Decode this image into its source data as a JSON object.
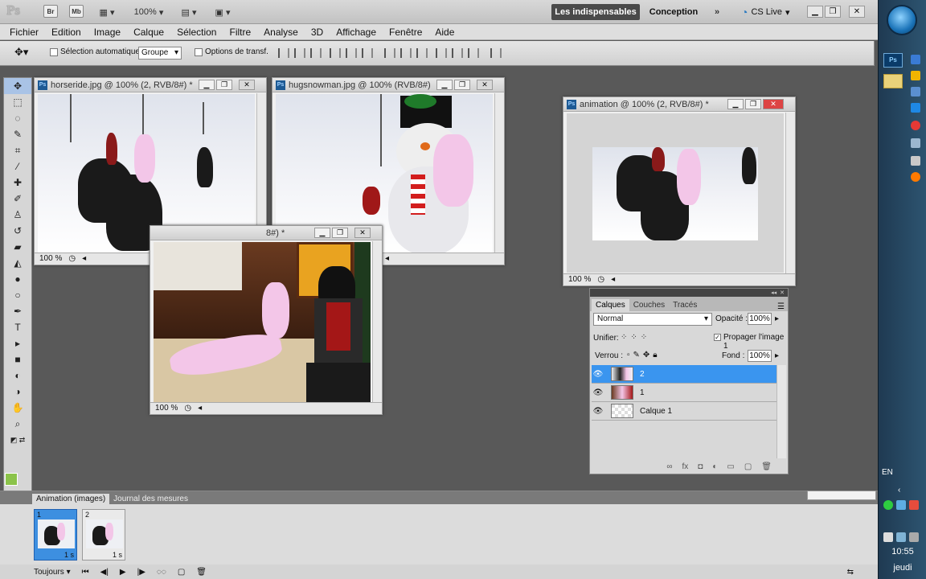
{
  "app": {
    "logo": "Ps",
    "mini_buttons": [
      "Br",
      "Mb"
    ],
    "zoom": "100%",
    "workspace_active": "Les indispensables",
    "workspace_other": "Conception",
    "cs_live": "CS Live"
  },
  "menu": [
    "Fichier",
    "Edition",
    "Image",
    "Calque",
    "Sélection",
    "Filtre",
    "Analyse",
    "3D",
    "Affichage",
    "Fenêtre",
    "Aide"
  ],
  "options": {
    "auto_select_label": "Sélection automatique :",
    "auto_select_value": "Groupe",
    "transform_label": "Options de transf."
  },
  "documents": [
    {
      "title": "horseride.jpg @ 100% (2, RVB/8#) *",
      "zoom": "100 %"
    },
    {
      "title": "hugsnowman.jpg @ 100% (RVB/8#)",
      "zoom": ""
    },
    {
      "title": "8#) *",
      "zoom": "100 %"
    },
    {
      "title": "animation  @ 100% (2, RVB/8#) *",
      "zoom": "100 %"
    }
  ],
  "layers_panel": {
    "tabs": [
      "Calques",
      "Couches",
      "Tracés"
    ],
    "blend_mode": "Normal",
    "opacity_label": "Opacité :",
    "opacity": "100%",
    "unify_label": "Unifier:",
    "propagate_label": "Propager l'image 1",
    "lock_label": "Verrou :",
    "fill_label": "Fond :",
    "fill": "100%",
    "layers": [
      {
        "name": "2",
        "selected": true
      },
      {
        "name": "1",
        "selected": false
      },
      {
        "name": "Calque 1",
        "selected": false
      }
    ]
  },
  "animation": {
    "tabs": [
      "Animation (images)",
      "Journal des mesures"
    ],
    "frames": [
      {
        "number": "1",
        "delay": "1 s",
        "selected": true
      },
      {
        "number": "2",
        "delay": "1 s",
        "selected": false
      }
    ],
    "loop": "Toujours"
  },
  "taskbar": {
    "lang": "EN",
    "time": "10:55",
    "day": "jeudi"
  }
}
